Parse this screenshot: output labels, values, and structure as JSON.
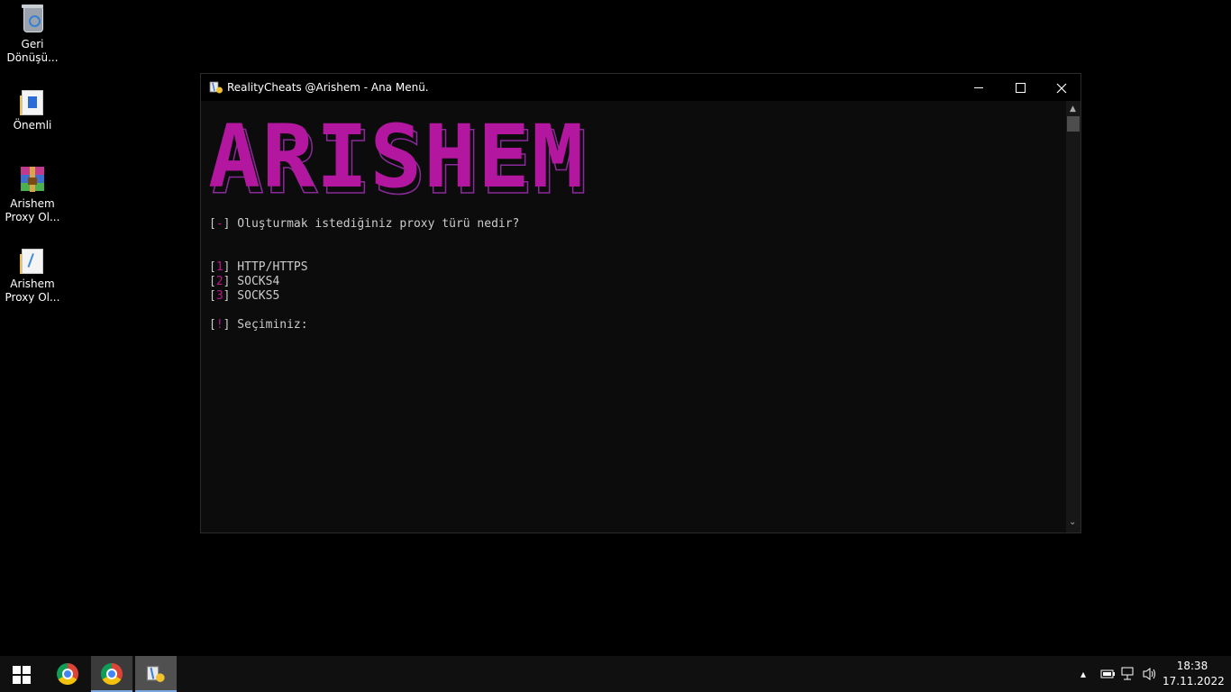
{
  "desktop": {
    "icons": [
      {
        "label": "Geri\nDönüşü...",
        "line1": "Geri",
        "line2": "Dönüşü...",
        "icon": "recycle-bin-icon"
      },
      {
        "label": "Önemli",
        "line1": "Önemli",
        "line2": "",
        "icon": "folder-icon"
      },
      {
        "label": "Arishem Proxy Ol...",
        "line1": "Arishem",
        "line2": "Proxy Ol...",
        "icon": "winrar-icon"
      },
      {
        "label": "Arishem Proxy Ol...",
        "line1": "Arishem",
        "line2": "Proxy Ol...",
        "icon": "folder-icon"
      }
    ]
  },
  "window": {
    "title": "RealityCheats @Arishem - Ana Menü.",
    "logo_text": "ARISHEM",
    "console": {
      "question_marker": "-",
      "question": " Oluşturmak istediğiniz proxy türü nedir?",
      "options": [
        {
          "num": "1",
          "label": " HTTP/HTTPS"
        },
        {
          "num": "2",
          "label": " SOCKS4"
        },
        {
          "num": "3",
          "label": " SOCKS5"
        }
      ],
      "prompt_marker": "!",
      "prompt": " Seçiminiz:"
    },
    "accent_color": "#c0148f"
  },
  "taskbar": {
    "clock_time": "18:38",
    "clock_date": "17.11.2022"
  }
}
